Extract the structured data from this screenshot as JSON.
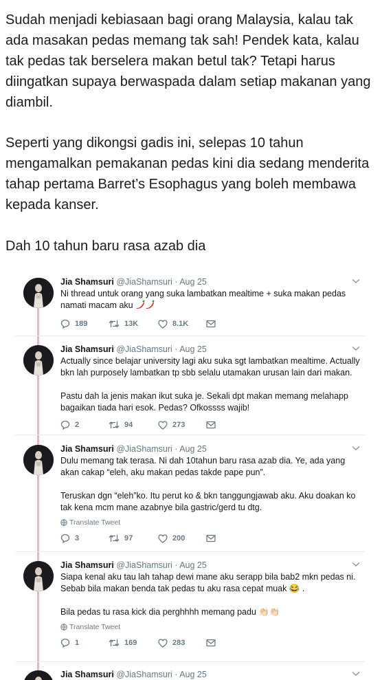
{
  "article": {
    "paragraph_1": "Sudah menjadi kebiasaan bagi orang Malaysia, kalau tak ada masakan pedas memang tak sah! Pendek kata, kalau tak pedas tak berselera makan betul tak? Tetapi harus diingatkan supaya berwaspada dalam setiap makanan yang diambil.",
    "paragraph_2": "Seperti yang dikongsi gadis ini, selepas 10 tahun mengamalkan pemakanan pedas kini dia sedang menderita tahap pertama Barret’s Esophagus yang boleh membawa kepada kanser.",
    "paragraph_3": "Dah 10 tahun baru rasa azab dia"
  },
  "translate_label": "Translate Tweet",
  "colors": {
    "thread_line": "#e1b8c8",
    "meta": "#657786",
    "text": "#14171a"
  },
  "tweets": [
    {
      "name": "Jia Shamsuri",
      "handle": "@JiaShamsuri",
      "date": "Aug 25",
      "text": "Ni thread untuk orang yang suka lambatkan mealtime + suka makan pedas namati macam aku",
      "emoji": "chili-pepper-x2",
      "replies": "189",
      "retweets": "13K",
      "likes": "8.1K"
    },
    {
      "name": "Jia Shamsuri",
      "handle": "@JiaShamsuri",
      "date": "Aug 25",
      "text": "Actually since belajar university lagi aku suka sgt lambatkan mealtime. Actually bkn lah purposely lambatkan tp sbb selalu utamakan urusan lain dari makan.\n\nPastu dah la jenis makan ikut suka je. Sekali dpt makan memang melahapp bagaikan tiada hari esok. Pedas? Ofkossss wajib!",
      "replies": "2",
      "retweets": "94",
      "likes": "273"
    },
    {
      "name": "Jia Shamsuri",
      "handle": "@JiaShamsuri",
      "date": "Aug 25",
      "text": "Dulu memang tak terasa. Ni dah 10tahun baru rasa azab dia. Ye, ada yang akan cakap “eleh, aku makan pedas takde pape pun”.\n\nTeruskan dgn “eleh”ko. Itu perut ko & bkn tanggungjawab aku. Aku doakan ko tak kena mcm mane azabnye bila gastric/gerd tu dtg.",
      "replies": "3",
      "retweets": "97",
      "likes": "200"
    },
    {
      "name": "Jia Shamsuri",
      "handle": "@JiaShamsuri",
      "date": "Aug 25",
      "text": "Siapa kenal aku tau lah tahap dewi mane aku serapp bila bab2 mkn pedas ni. Sebab bila makan benda tak pedas tu aku rasa cepat muak 😂 .\n\nBila pedas tu rasa kick dia perghhhh memang padu 👏🏻👏🏻",
      "replies": "1",
      "retweets": "169",
      "likes": "283"
    },
    {
      "name": "Jia Shamsuri",
      "handle": "@JiaShamsuri",
      "date": "Aug 25"
    }
  ],
  "separator": " · "
}
